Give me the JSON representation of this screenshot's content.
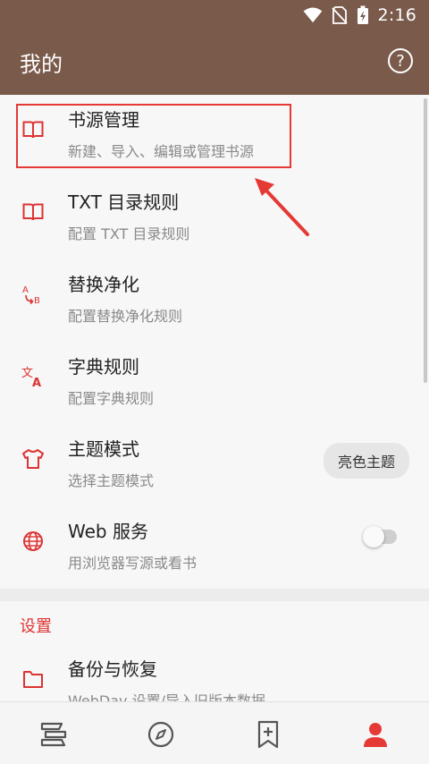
{
  "status_bar": {
    "time": "2:16"
  },
  "appbar": {
    "title": "我的"
  },
  "items": [
    {
      "title": "书源管理",
      "sub": "新建、导入、编辑或管理书源",
      "icon": "book-icon"
    },
    {
      "title": "TXT 目录规则",
      "sub": "配置 TXT 目录规则",
      "icon": "book-icon"
    },
    {
      "title": "替换净化",
      "sub": "配置替换净化规则",
      "icon": "replace-ab-icon"
    },
    {
      "title": "字典规则",
      "sub": "配置字典规则",
      "icon": "translate-icon"
    },
    {
      "title": "主题模式",
      "sub": "选择主题模式",
      "icon": "shirt-icon",
      "chip": "亮色主题"
    },
    {
      "title": "Web 服务",
      "sub": "用浏览器写源或看书",
      "icon": "globe-icon",
      "toggle": false
    }
  ],
  "settings": {
    "header": "设置",
    "items": [
      {
        "title": "备份与恢复",
        "sub": "WebDav 设置/导入旧版本数据",
        "icon": "folder-icon"
      }
    ]
  },
  "bottom_nav": [
    {
      "name": "bookshelf",
      "icon": "bookshelf-icon",
      "active": false
    },
    {
      "name": "discover",
      "icon": "compass-icon",
      "active": false
    },
    {
      "name": "rss",
      "icon": "bookmark-add-icon",
      "active": false
    },
    {
      "name": "my",
      "icon": "person-icon",
      "active": true
    }
  ],
  "colors": {
    "brand": "#7a5a4b",
    "accent": "#dd3333",
    "highlight": "#e53935"
  }
}
